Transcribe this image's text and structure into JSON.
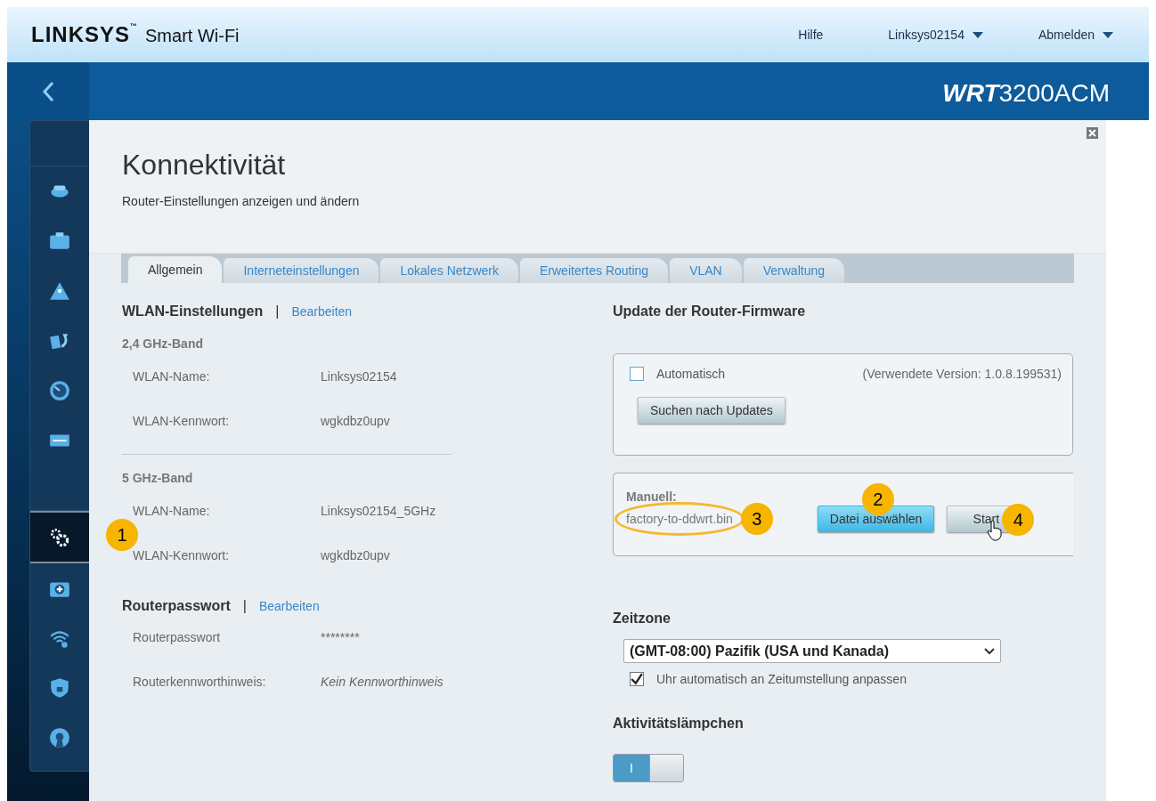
{
  "header": {
    "logo": "LINKSYS",
    "trademark": "™",
    "product": "Smart Wi-Fi",
    "links": [
      {
        "label": "Hilfe",
        "dropdown": false
      },
      {
        "label": "Linksys02154",
        "dropdown": true
      },
      {
        "label": "Abmelden",
        "dropdown": true
      }
    ]
  },
  "banner": {
    "brand": "WRT",
    "model": "3200ACM"
  },
  "sidebar": {
    "items": [
      {
        "kind": "blank",
        "selected": false
      },
      {
        "kind": "router",
        "selected": false
      },
      {
        "kind": "devices",
        "selected": false
      },
      {
        "kind": "parental",
        "selected": false
      },
      {
        "kind": "backup",
        "selected": false
      },
      {
        "kind": "speed",
        "selected": false
      },
      {
        "kind": "usb",
        "selected": false
      },
      {
        "kind": "blank",
        "selected": false
      },
      {
        "kind": "gears",
        "selected": true,
        "callout": "1"
      },
      {
        "kind": "health",
        "selected": false
      },
      {
        "kind": "wireless",
        "selected": false
      },
      {
        "kind": "security",
        "selected": false
      },
      {
        "kind": "vpn",
        "selected": false
      }
    ]
  },
  "page": {
    "title": "Konnektivität",
    "subtitle": "Router-Einstellungen anzeigen und ändern"
  },
  "tabs": [
    {
      "label": "Allgemein",
      "selected": true
    },
    {
      "label": "Interneteinstellungen",
      "selected": false
    },
    {
      "label": "Lokales Netzwerk",
      "selected": false
    },
    {
      "label": "Erweitertes Routing",
      "selected": false
    },
    {
      "label": "VLAN",
      "selected": false
    },
    {
      "label": "Verwaltung",
      "selected": false
    }
  ],
  "wlan": {
    "heading": "WLAN-Einstellungen",
    "separator": "|",
    "edit": "Bearbeiten",
    "bands": [
      {
        "name": "2,4 GHz-Band",
        "fields": [
          {
            "label": "WLAN-Name:",
            "value": "Linksys02154"
          },
          {
            "label": "WLAN-Kennwort:",
            "value": "wgkdbz0upv"
          }
        ]
      },
      {
        "name": "5 GHz-Band",
        "fields": [
          {
            "label": "WLAN-Name:",
            "value": "Linksys02154_5GHz"
          },
          {
            "label": "WLAN-Kennwort:",
            "value": "wgkdbz0upv"
          }
        ]
      }
    ]
  },
  "router_password": {
    "heading": "Routerpasswort",
    "separator": "|",
    "edit": "Bearbeiten",
    "fields": [
      {
        "label": "Routerpasswort",
        "value": "********",
        "italic": false
      },
      {
        "label": "Routerkennworthinweis:",
        "value": "Kein Kennworthinweis",
        "italic": true
      }
    ]
  },
  "firmware": {
    "heading": "Update der Router-Firmware",
    "auto": {
      "label": "Automatisch",
      "checked": false
    },
    "version": "(Verwendete Version: 1.0.8.199531)",
    "check_button": "Suchen nach Updates",
    "manual": {
      "label": "Manuell:",
      "file": "factory-to-ddwrt.bin",
      "file_callout": "3",
      "choose_button": "Datei auswählen",
      "choose_callout": "2",
      "start_button": "Start",
      "start_callout": "4"
    }
  },
  "timezone": {
    "heading": "Zeitzone",
    "value": "(GMT-08:00) Pazifik (USA und Kanada)",
    "dst": {
      "label": "Uhr automatisch an Zeitumstellung anpassen",
      "checked": true
    }
  },
  "activity_lights": {
    "heading": "Aktivitätslämpchen",
    "toggle_label": "I",
    "on": true
  }
}
